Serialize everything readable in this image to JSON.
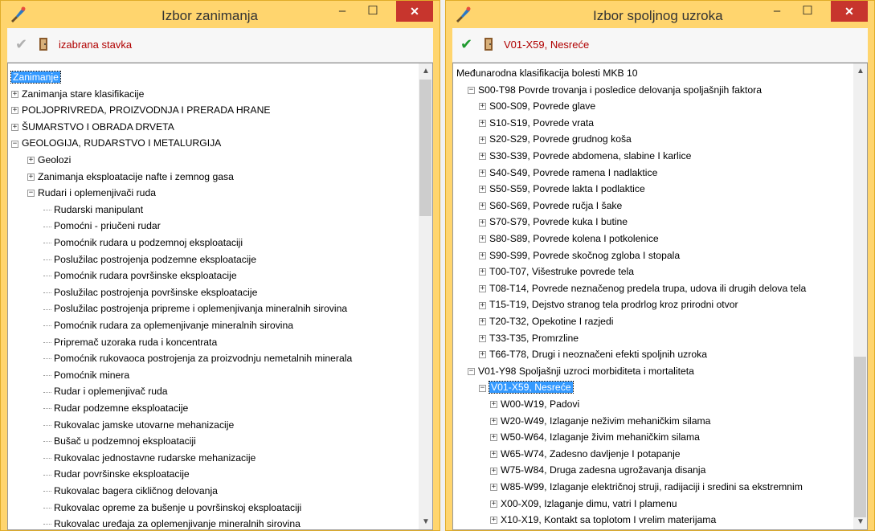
{
  "window1": {
    "title": "Izbor zanimanja",
    "minimize": "–",
    "maximize": "☐",
    "close": "✕",
    "toolbar_label": "izabrana stavka",
    "tree": [
      {
        "level": 0,
        "text": "Zanimanje",
        "expander": "none",
        "selected": true
      },
      {
        "level": 0,
        "text": "Zanimanja stare klasifikacije",
        "expander": "+"
      },
      {
        "level": 0,
        "text": "POLJOPRIVREDA, PROIZVODNJA I PRERADA HRANE",
        "expander": "+"
      },
      {
        "level": 0,
        "text": "ŠUMARSTVO I OBRADA DRVETA",
        "expander": "+"
      },
      {
        "level": 0,
        "text": "GEOLOGIJA, RUDARSTVO I METALURGIJA",
        "expander": "-"
      },
      {
        "level": 1,
        "text": "Geolozi",
        "expander": "+"
      },
      {
        "level": 1,
        "text": "Zanimanja eksploatacije nafte i zemnog gasa",
        "expander": "+"
      },
      {
        "level": 1,
        "text": "Rudari i oplemenjivači ruda",
        "expander": "-"
      },
      {
        "level": 2,
        "text": "Rudarski manipulant",
        "expander": "leaf"
      },
      {
        "level": 2,
        "text": "Pomoćni - priučeni rudar",
        "expander": "leaf"
      },
      {
        "level": 2,
        "text": "Pomoćnik rudara u podzemnoj eksploataciji",
        "expander": "leaf"
      },
      {
        "level": 2,
        "text": "Poslužilac postrojenja podzemne eksploatacije",
        "expander": "leaf"
      },
      {
        "level": 2,
        "text": "Pomoćnik rudara površinske eksploatacije",
        "expander": "leaf"
      },
      {
        "level": 2,
        "text": "Poslužilac postrojenja površinske eksploatacije",
        "expander": "leaf"
      },
      {
        "level": 2,
        "text": "Poslužilac postrojenja pripreme i oplemenjivanja mineralnih sirovina",
        "expander": "leaf"
      },
      {
        "level": 2,
        "text": "Pomoćnik rudara za oplemenjivanje mineralnih sirovina",
        "expander": "leaf"
      },
      {
        "level": 2,
        "text": "Pripremač uzoraka ruda i koncentrata",
        "expander": "leaf"
      },
      {
        "level": 2,
        "text": "Pomoćnik rukovaoca postrojenja za proizvodnju nemetalnih minerala",
        "expander": "leaf"
      },
      {
        "level": 2,
        "text": "Pomoćnik minera",
        "expander": "leaf"
      },
      {
        "level": 2,
        "text": "Rudar i oplemenjivač ruda",
        "expander": "leaf"
      },
      {
        "level": 2,
        "text": "Rudar podzemne eksploatacije",
        "expander": "leaf"
      },
      {
        "level": 2,
        "text": "Rukovalac jamske utovarne mehanizacije",
        "expander": "leaf"
      },
      {
        "level": 2,
        "text": "Bušač u podzemnoj eksploataciji",
        "expander": "leaf"
      },
      {
        "level": 2,
        "text": "Rukovalac jednostavne rudarske mehanizacije",
        "expander": "leaf"
      },
      {
        "level": 2,
        "text": "Rudar površinske eksploatacije",
        "expander": "leaf"
      },
      {
        "level": 2,
        "text": "Rukovalac bagera cikličnog delovanja",
        "expander": "leaf"
      },
      {
        "level": 2,
        "text": "Rukovalac opreme za bušenje u površinskoj eksploataciji",
        "expander": "leaf"
      },
      {
        "level": 2,
        "text": "Rukovalac uređaja za oplemenjivanje mineralnih sirovina",
        "expander": "leaf"
      }
    ]
  },
  "window2": {
    "title": "Izbor spoljnog uzroka",
    "minimize": "–",
    "maximize": "☐",
    "close": "✕",
    "toolbar_label": "V01-X59, Nesreće",
    "tree": [
      {
        "level": 0,
        "text": "Međunarodna klasifikacija bolesti MKB 10",
        "expander": "none"
      },
      {
        "level": 1,
        "text": "S00-T98 Povrde trovanja i posledice delovanja spoljašnjih faktora",
        "expander": "-"
      },
      {
        "level": 2,
        "text": "S00-S09, Povrede glave",
        "expander": "+"
      },
      {
        "level": 2,
        "text": "S10-S19, Povrede vrata",
        "expander": "+"
      },
      {
        "level": 2,
        "text": "S20-S29, Povrede grudnog koša",
        "expander": "+"
      },
      {
        "level": 2,
        "text": "S30-S39, Povrede abdomena, slabine I karlice",
        "expander": "+"
      },
      {
        "level": 2,
        "text": "S40-S49, Povrede ramena I nadlaktice",
        "expander": "+"
      },
      {
        "level": 2,
        "text": "S50-S59, Povrede lakta I podlaktice",
        "expander": "+"
      },
      {
        "level": 2,
        "text": "S60-S69, Povrede ručja I šake",
        "expander": "+"
      },
      {
        "level": 2,
        "text": "S70-S79, Povrede kuka I butine",
        "expander": "+"
      },
      {
        "level": 2,
        "text": "S80-S89, Povrede kolena I potkolenice",
        "expander": "+"
      },
      {
        "level": 2,
        "text": "S90-S99, Povrede skočnog zgloba I stopala",
        "expander": "+"
      },
      {
        "level": 2,
        "text": "T00-T07, Višestruke povrede tela",
        "expander": "+"
      },
      {
        "level": 2,
        "text": "T08-T14, Povrede neznačenog predela trupa, udova ili drugih delova tela",
        "expander": "+"
      },
      {
        "level": 2,
        "text": "T15-T19, Dejstvo stranog tela prodrlog kroz prirodni otvor",
        "expander": "+"
      },
      {
        "level": 2,
        "text": "T20-T32, Opekotine I razjedi",
        "expander": "+"
      },
      {
        "level": 2,
        "text": "T33-T35, Promrzline",
        "expander": "+"
      },
      {
        "level": 2,
        "text": "T66-T78, Drugi i neoznačeni efekti spoljnih uzroka",
        "expander": "+"
      },
      {
        "level": 1,
        "text": "V01-Y98 Spoljašnji uzroci morbiditeta i mortaliteta",
        "expander": "-"
      },
      {
        "level": 2,
        "text": "V01-X59, Nesreće",
        "expander": "-",
        "selected": true
      },
      {
        "level": 3,
        "text": "W00-W19, Padovi",
        "expander": "+"
      },
      {
        "level": 3,
        "text": "W20-W49, Izlaganje neživim mehaničkim silama",
        "expander": "+"
      },
      {
        "level": 3,
        "text": "W50-W64, Izlaganje živim mehaničkim silama",
        "expander": "+"
      },
      {
        "level": 3,
        "text": "W65-W74, Zadesno davljenje I potapanje",
        "expander": "+"
      },
      {
        "level": 3,
        "text": "W75-W84, Druga zadesna ugrožavanja disanja",
        "expander": "+"
      },
      {
        "level": 3,
        "text": "W85-W99, Izlaganje električnoj struji, radijaciji i sredini sa ekstremnim",
        "expander": "+"
      },
      {
        "level": 3,
        "text": "X00-X09, Izlaganje dimu, vatri I plamenu",
        "expander": "+"
      },
      {
        "level": 3,
        "text": "X10-X19, Kontakt sa toplotom I vrelim materijama",
        "expander": "+"
      }
    ]
  }
}
